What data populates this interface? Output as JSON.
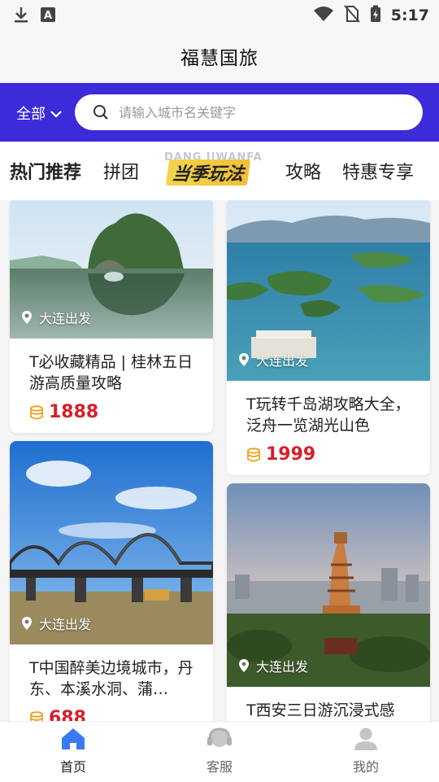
{
  "status_bar": {
    "time": "5:17",
    "icons": [
      "download-icon",
      "font-a-icon",
      "wifi-icon",
      "no-sim-icon",
      "battery-charging-icon"
    ]
  },
  "app": {
    "title": "福慧国旅"
  },
  "search": {
    "region": "全部",
    "placeholder": "请输入城市名关键字"
  },
  "tabs": [
    {
      "label": "热门推荐",
      "active": true
    },
    {
      "label": "拼团"
    },
    {
      "label": "当季玩法",
      "ghost": "DANG JIWANFA"
    },
    {
      "label": "攻略"
    },
    {
      "label": "特惠专享"
    }
  ],
  "cards": [
    {
      "title": "T必收藏精品 | 桂林五日游高质量攻略",
      "location": "大连出发",
      "price": "1888",
      "scene": "guilin"
    },
    {
      "title": "T玩转千岛湖攻略大全，泛舟一览湖光山色",
      "location": "大连出发",
      "price": "1999",
      "scene": "qiandaohu"
    },
    {
      "title": "T中国醉美边境城市，丹东、本溪水洞、蒲…",
      "location": "大连出发",
      "price": "688",
      "scene": "dandong"
    },
    {
      "title": "T西安三日游沉浸式感",
      "location": "大连出发",
      "price": "",
      "scene": "xian"
    }
  ],
  "bottom_nav": [
    {
      "label": "首页",
      "icon": "home-icon",
      "active": true
    },
    {
      "label": "客服",
      "icon": "headset-icon"
    },
    {
      "label": "我的",
      "icon": "user-icon"
    }
  ],
  "colors": {
    "brand": "#3b2bd9",
    "price": "#d71f2b",
    "coin": "#f0a020",
    "nav_active": "#3a7bf2"
  }
}
